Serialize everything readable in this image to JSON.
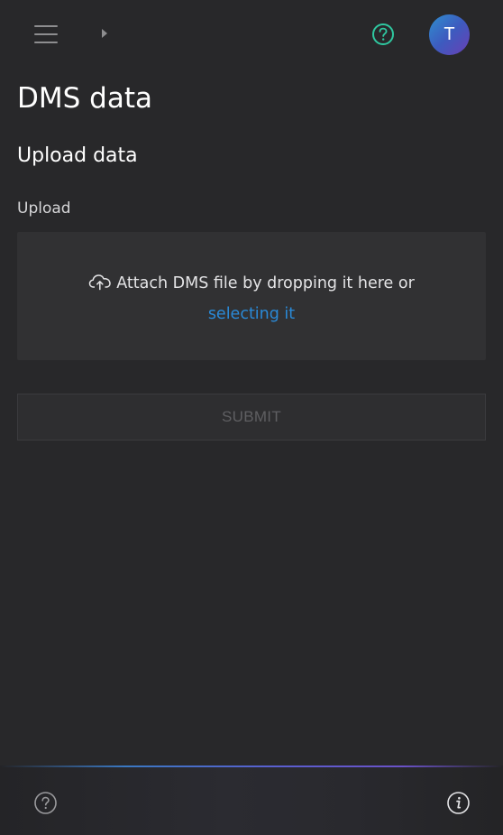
{
  "header": {
    "menu_icon": "hamburger-menu-icon",
    "caret_icon": "caret-right-icon",
    "help_icon": "help-circle-icon",
    "help_color": "#2fc8a0",
    "avatar_initial": "T",
    "avatar_colors": [
      "#2f8fcf",
      "#6a3fb5"
    ]
  },
  "page": {
    "title": "DMS data",
    "section_title": "Upload data"
  },
  "upload": {
    "label": "Upload",
    "drop_text": "Attach DMS file by dropping it here or",
    "select_link": "selecting it",
    "cloud_icon": "cloud-upload-icon",
    "link_color": "#2a8ad8"
  },
  "form": {
    "submit_label": "SUBMIT"
  },
  "footer": {
    "help_icon": "help-circle-icon",
    "info_icon": "info-circle-icon"
  }
}
